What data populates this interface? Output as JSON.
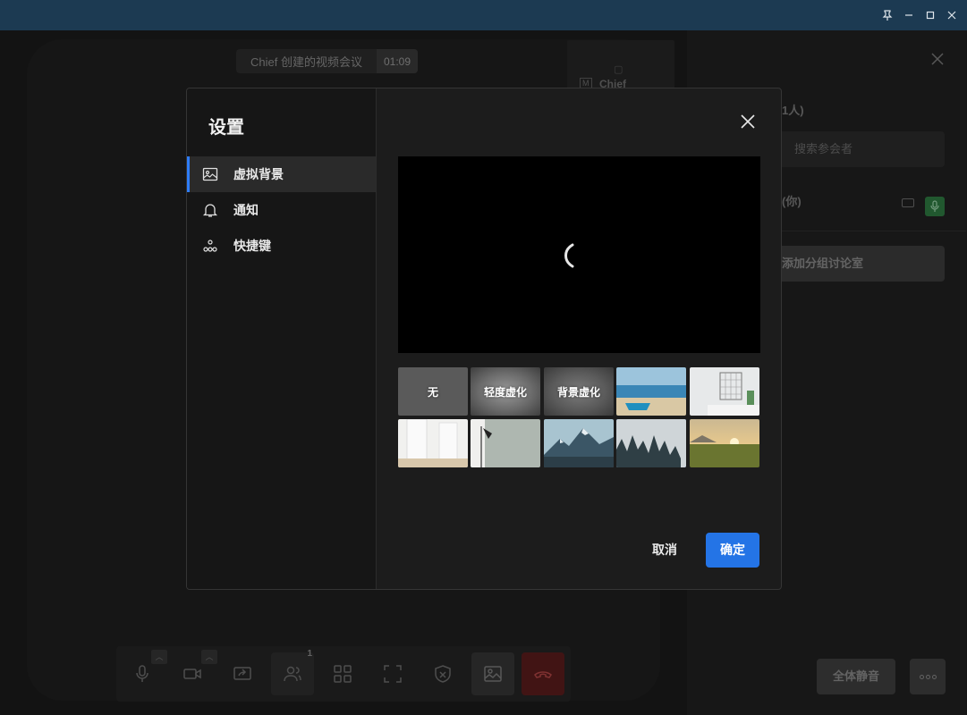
{
  "window": {
    "controls": [
      "pin-icon",
      "minimize-icon",
      "maximize-icon",
      "close-icon"
    ]
  },
  "meeting": {
    "title": "Chief 创建的视频会议",
    "duration": "01:09",
    "thumbnail_badge": "M",
    "thumbnail_name": "Chief"
  },
  "participants_panel": {
    "count_label": "1人)",
    "search_placeholder": "搜索参会者",
    "self_label": "(你)",
    "breakout_button": "添加分组讨论室",
    "mute_all_button": "全体静音",
    "more_button_icon": "more-icon",
    "mic_color": "#2f7a42"
  },
  "toolbar": {
    "buttons": [
      "mic-icon",
      "camera-icon",
      "share-screen-icon",
      "participants-icon",
      "gallery-icon",
      "fullscreen-icon",
      "security-icon",
      "virtual-background-icon",
      "hang-up-icon"
    ],
    "participants_badge": "1"
  },
  "settings": {
    "title": "设置",
    "nav": [
      {
        "label": "虚拟背景",
        "icon": "image-icon",
        "active": true
      },
      {
        "label": "通知",
        "icon": "bell-icon",
        "active": false
      },
      {
        "label": "快捷键",
        "icon": "shortcut-icon",
        "active": false
      }
    ],
    "backgrounds": {
      "none": "无",
      "light_blur": "轻度虚化",
      "background_blur": "背景虚化",
      "images": [
        "beach-scene",
        "white-room-shelf",
        "white-hallway",
        "lamp-wall",
        "mountain-peaks",
        "foggy-forest",
        "sunset-field"
      ],
      "selected": "foggy-forest"
    },
    "cancel_button": "取消",
    "confirm_button": "确定",
    "accent_color": "#2474e6"
  }
}
